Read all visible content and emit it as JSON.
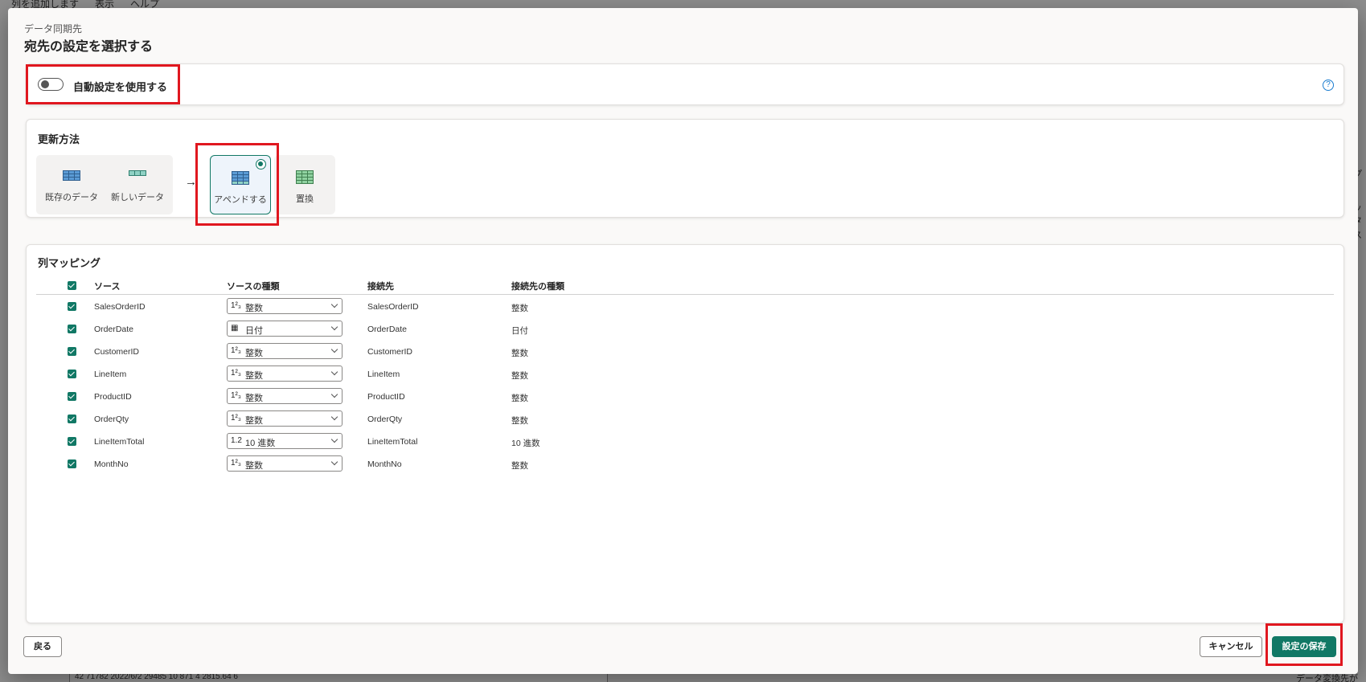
{
  "background": {
    "menu": [
      "列を追加します",
      "表示",
      "ヘルプ"
    ],
    "right_fragments": [
      "ップ",
      "ヘッ",
      "別タ",
      "カス"
    ],
    "bottom_row": "42    71782    2022/6/2    29485    10    871    4    2815.64    6",
    "bottom_right_text": "データ変換先があり"
  },
  "dialog": {
    "subtitle": "データ同期先",
    "title": "宛先の設定を選択する"
  },
  "auto_settings": {
    "label": "自動設定を使用する",
    "enabled": false,
    "help_glyph": "?"
  },
  "update_method": {
    "title": "更新方法",
    "existing_label": "既存のデータ",
    "new_label": "新しいデータ",
    "arrow": "→",
    "options": [
      {
        "label": "アペンドする",
        "selected": true
      },
      {
        "label": "置換",
        "selected": false
      }
    ]
  },
  "mapping": {
    "title": "列マッピング",
    "headers": {
      "source": "ソース",
      "source_type": "ソースの種類",
      "destination": "接続先",
      "destination_type": "接続先の種類"
    },
    "rows": [
      {
        "source": "SalesOrderID",
        "type_icon": "1²₃",
        "type": "整数",
        "destination": "SalesOrderID",
        "dest_type": "整数"
      },
      {
        "source": "OrderDate",
        "type_icon": "▦",
        "type": "日付",
        "destination": "OrderDate",
        "dest_type": "日付"
      },
      {
        "source": "CustomerID",
        "type_icon": "1²₃",
        "type": "整数",
        "destination": "CustomerID",
        "dest_type": "整数"
      },
      {
        "source": "LineItem",
        "type_icon": "1²₃",
        "type": "整数",
        "destination": "LineItem",
        "dest_type": "整数"
      },
      {
        "source": "ProductID",
        "type_icon": "1²₃",
        "type": "整数",
        "destination": "ProductID",
        "dest_type": "整数"
      },
      {
        "source": "OrderQty",
        "type_icon": "1²₃",
        "type": "整数",
        "destination": "OrderQty",
        "dest_type": "整数"
      },
      {
        "source": "LineItemTotal",
        "type_icon": "1.2",
        "type": "10 進数",
        "destination": "LineItemTotal",
        "dest_type": "10 進数"
      },
      {
        "source": "MonthNo",
        "type_icon": "1²₃",
        "type": "整数",
        "destination": "MonthNo",
        "dest_type": "整数"
      }
    ]
  },
  "footer": {
    "back": "戻る",
    "cancel": "キャンセル",
    "save": "設定の保存"
  },
  "colors": {
    "accent": "#117865",
    "highlight": "#e0171f",
    "link": "#1a7ccf"
  }
}
